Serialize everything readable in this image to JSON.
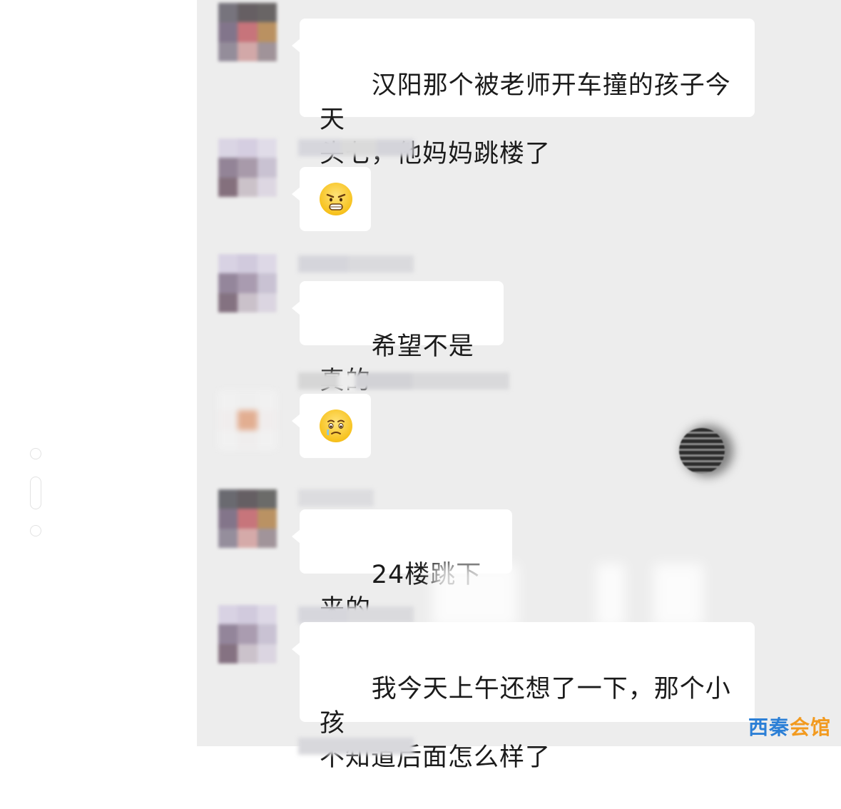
{
  "colors": {
    "chat_background": "#ededed",
    "bubble_background": "#ffffff",
    "text": "#1b1b1b",
    "watermark_blue": "#2b7fd6",
    "watermark_orange": "#f29a1f"
  },
  "messages": [
    {
      "type": "text",
      "text": "汉阳那个被老师开车撞的孩子今天\n头七，他妈妈跳楼了"
    },
    {
      "type": "emoji",
      "emoji": "scared-face-icon"
    },
    {
      "type": "text",
      "text": "希望不是真的"
    },
    {
      "type": "emoji",
      "emoji": "teary-face-icon"
    },
    {
      "type": "text",
      "text": "24楼跳下来的"
    },
    {
      "type": "text",
      "text": "我今天上午还想了一下，那个小孩\n不知道后面怎么样了"
    }
  ],
  "watermark": {
    "part1": "西秦",
    "part2": "会馆"
  }
}
